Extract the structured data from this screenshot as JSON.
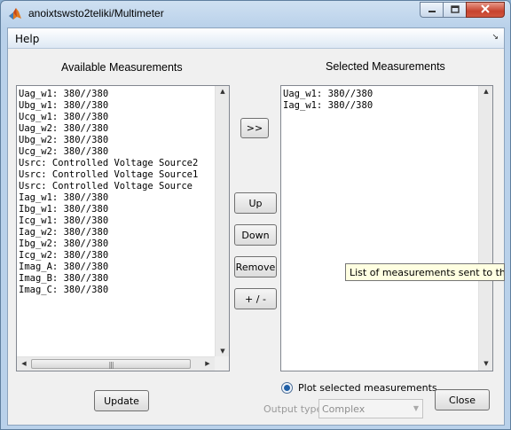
{
  "window": {
    "title": "anoixtswsto2teliki/Multimeter"
  },
  "menu": {
    "help": "Help"
  },
  "available": {
    "title": "Available Measurements",
    "items": [
      "Uag_w1: 380//380",
      "Ubg_w1: 380//380",
      "Ucg_w1: 380//380",
      "Uag_w2: 380//380",
      "Ubg_w2: 380//380",
      "Ucg_w2: 380//380",
      "Usrc: Controlled Voltage Source2",
      "Usrc: Controlled Voltage Source1",
      "Usrc: Controlled Voltage Source",
      "Iag_w1: 380//380",
      "Ibg_w1: 380//380",
      "Icg_w1: 380//380",
      "Iag_w2: 380//380",
      "Ibg_w2: 380//380",
      "Icg_w2: 380//380",
      "Imag_A: 380//380",
      "Imag_B: 380//380",
      "Imag_C: 380//380"
    ]
  },
  "selected": {
    "title": "Selected Measurements",
    "items": [
      "Uag_w1: 380//380",
      "Iag_w1: 380//380"
    ]
  },
  "buttons": {
    "add": ">>",
    "up": "Up",
    "down": "Down",
    "remove": "Remove",
    "sign": "+ / -",
    "update": "Update",
    "close": "Close"
  },
  "plot": {
    "label": "Plot selected measurements",
    "checked": true
  },
  "output": {
    "label": "Output type:",
    "value": "Complex"
  },
  "tooltip": {
    "text": "List of measurements sent to the"
  },
  "icons": {
    "app": "matlab-logo-icon",
    "minimize": "minimize-icon",
    "maximize": "maximize-icon",
    "close": "close-icon",
    "menu_toggle": "menu-toggle-icon"
  }
}
